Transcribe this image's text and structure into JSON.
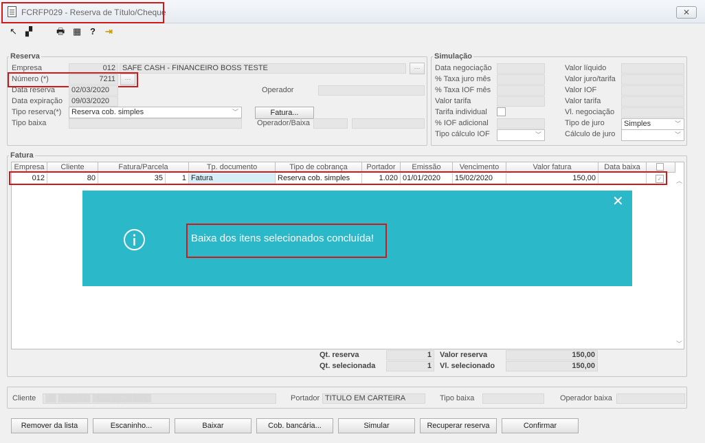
{
  "window": {
    "title": "FCRFP029 - Reserva de Título/Cheque",
    "close_icon": "✕"
  },
  "toolbar": {
    "tools": [
      "↖",
      "▞",
      "🖶",
      "▦",
      "?",
      "⇥"
    ]
  },
  "reserva": {
    "legend": "Reserva",
    "empresa_label": "Empresa",
    "empresa_code": "012",
    "empresa_name": "SAFE CASH - FINANCEIRO BOSS TESTE",
    "numero_label": "Número (*)",
    "numero_value": "7211",
    "data_reserva_label": "Data reserva",
    "data_reserva_value": "02/03/2020",
    "data_expiracao_label": "Data expiração",
    "data_expiracao_value": "09/03/2020",
    "operador_label": "Operador",
    "operador_value": "",
    "tipo_reserva_label": "Tipo reserva(*)",
    "tipo_reserva_value": "Reserva cob. simples",
    "fatura_button": "Fatura...",
    "tipo_baixa_label": "Tipo baixa",
    "tipo_baixa_value": "",
    "operador_baixa_label": "Operador/Baixa"
  },
  "simulacao": {
    "legend": "Simulação",
    "data_negociacao": "Data negociação",
    "taxa_juro": "% Taxa juro mês",
    "taxa_iof": "% Taxa IOF mês",
    "valor_tarifa": "Valor tarifa",
    "tarifa_individual": "Tarifa individual",
    "iof_adicional": "% IOF adicional",
    "tipo_calculo_iof": "Tipo  cálculo IOF",
    "valor_liquido": "Valor líquido",
    "valor_juro_tarifa": "Valor juro/tarifa",
    "valor_iof": "Valor IOF",
    "valor_tarifa_r": "Valor tarifa",
    "vl_negociacao": "Vl. negociação",
    "tipo_de_juro": "Tipo de juro",
    "tipo_de_juro_value": "Simples",
    "calculo_de_juro": "Cálculo de juro"
  },
  "fatura": {
    "legend": "Fatura",
    "columns": [
      "Empresa",
      "Cliente",
      "Fatura/Parcela",
      "Tp. documento",
      "Tipo de cobrança",
      "Portador",
      "Emissão",
      "Vencimento",
      "Valor fatura",
      "Data baixa"
    ],
    "row": {
      "empresa": "012",
      "cliente": "80",
      "fatura": "35",
      "parcela": "1",
      "tp_documento": "Fatura",
      "tipo_cobranca": "Reserva cob. simples",
      "portador": "1.020",
      "emissao": "01/01/2020",
      "vencimento": "15/02/2020",
      "valor_fatura": "150,00",
      "data_baixa": ""
    },
    "qt_reserva_label": "Qt. reserva",
    "qt_reserva_value": "1",
    "qt_selecionada_label": "Qt. selecionada",
    "qt_selecionada_value": "1",
    "valor_reserva_label": "Valor reserva",
    "valor_reserva_value": "150,00",
    "vl_selecionado_label": "Vl. selecionado",
    "vl_selecionado_value": "150,00"
  },
  "toast": {
    "message": "Baixa dos itens selecionados concluída!",
    "close": "✕",
    "info_icon": "info-circle-icon"
  },
  "footer": {
    "cliente_label": "Cliente",
    "portador_label": "Portador",
    "portador_value": "TITULO EM CARTEIRA",
    "tipo_baixa_label": "Tipo baixa",
    "operador_baixa_label": "Operador baixa"
  },
  "buttons": [
    "Remover da lista",
    "Escaninho...",
    "Baixar",
    "Cob. bancária...",
    "Simular",
    "Recuperar reserva",
    "Confirmar"
  ],
  "colors": {
    "toast": "#2bb8c8",
    "highlight": "#d01818",
    "selected_cell": "#d6eef8"
  }
}
